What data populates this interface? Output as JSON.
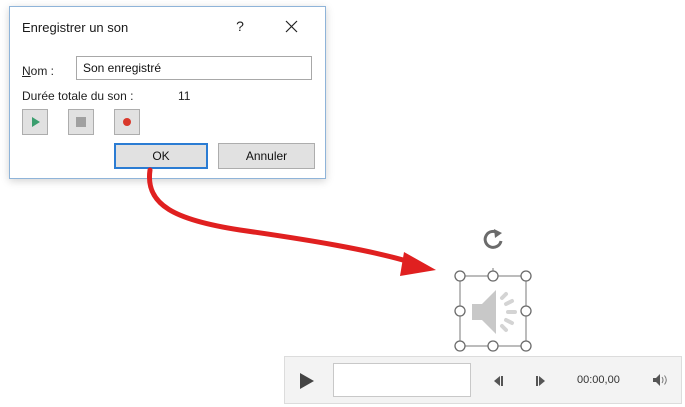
{
  "dialog": {
    "title": "Enregistrer un son",
    "help": "?",
    "name_label_underlined": "N",
    "name_label_rest": "om :",
    "name_value": "Son enregistré",
    "duration_label": "Durée totale du son :",
    "duration_value": "11",
    "controls": [
      "play-icon",
      "stop-icon",
      "record-icon"
    ],
    "ok_label": "OK",
    "cancel_label": "Annuler"
  },
  "player": {
    "time": "00:00,00",
    "icons": [
      "play-icon",
      "step-back-icon",
      "step-forward-icon",
      "volume-icon"
    ]
  },
  "colors": {
    "arrow": "#e02020",
    "ok_border": "#2b7cd3",
    "play_green": "#3a9e6e",
    "record_red": "#d9382b"
  }
}
